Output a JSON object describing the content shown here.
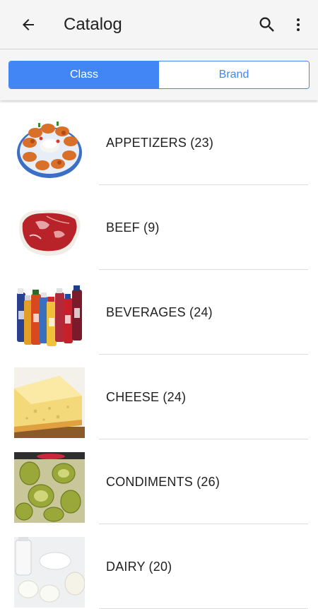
{
  "appbar": {
    "title": "Catalog",
    "back_icon": "arrow-left-icon",
    "search_icon": "search-icon",
    "more_icon": "more-vert-icon"
  },
  "tabs": [
    {
      "label": "Class",
      "selected": true
    },
    {
      "label": "Brand",
      "selected": false
    }
  ],
  "colors": {
    "accent": "#4285f4",
    "appbar_bg": "#f5f5f5",
    "text": "#212121",
    "divider": "#dcdcdc"
  },
  "categories": [
    {
      "label": "APPETIZERS (23)",
      "image": "appetizer-platter-image"
    },
    {
      "label": "BEEF (9)",
      "image": "raw-steak-image"
    },
    {
      "label": "BEVERAGES (24)",
      "image": "bottled-drinks-image"
    },
    {
      "label": "CHEESE (24)",
      "image": "cheese-wedge-image"
    },
    {
      "label": "CONDIMENTS (26)",
      "image": "pickle-jar-image"
    },
    {
      "label": "DAIRY (20)",
      "image": "dairy-products-image"
    }
  ]
}
